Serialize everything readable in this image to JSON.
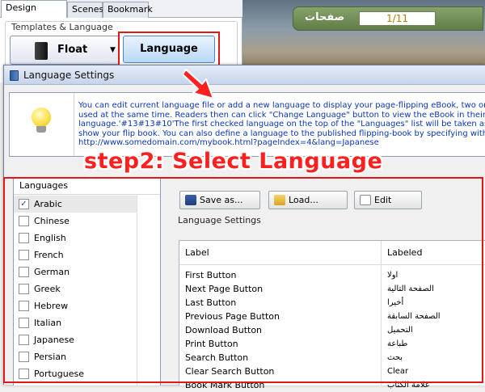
{
  "app": {
    "tabs": [
      "Design Setting",
      "Scenes",
      "Bookmark"
    ],
    "group_label": "Templates & Language",
    "float_label": "Float",
    "dropdown_glyph": "▼",
    "language_label": "Language"
  },
  "preview": {
    "page_counter": "1/11",
    "pages_label": "صفحات"
  },
  "dialog": {
    "title": "Language Settings",
    "info_lines": [
      "You can edit current language file or add a new language to display your page-flipping eBook, two or more",
      "used at the same time. Readers then can click \"Change Language\" button to view the eBook in their prefe",
      "language.'#13#13#10'The first checked language on the top of the \"Languages\" list will be taken as the d",
      "show your flip book. You can also define a language to the published flipping-book by specifying with the a",
      "http://www.somedomain.com/mybook.html?pageIndex=4&lang=Japanese"
    ],
    "languages_header": "Languages",
    "languages": [
      {
        "name": "Arabic",
        "checked": true
      },
      {
        "name": "Chinese",
        "checked": false
      },
      {
        "name": "English",
        "checked": false
      },
      {
        "name": "French",
        "checked": false
      },
      {
        "name": "German",
        "checked": false
      },
      {
        "name": "Greek",
        "checked": false
      },
      {
        "name": "Hebrew",
        "checked": false
      },
      {
        "name": "Italian",
        "checked": false
      },
      {
        "name": "Japanese",
        "checked": false
      },
      {
        "name": "Persian",
        "checked": false
      },
      {
        "name": "Portuguese",
        "checked": false
      }
    ],
    "toolbar": {
      "save": "Save as...",
      "load": "Load...",
      "edit": "Edit"
    },
    "settings_label": "Language Settings",
    "grid_headers": {
      "label": "Label",
      "labeled": "Labeled"
    },
    "rows": [
      {
        "label": "First Button",
        "value": "اولا"
      },
      {
        "label": "Next Page Button",
        "value": "الصفحة التالية"
      },
      {
        "label": "Last Button",
        "value": "أخيرا"
      },
      {
        "label": "Previous Page Button",
        "value": "الصفحة السابقة"
      },
      {
        "label": "Download Button",
        "value": "التحميل"
      },
      {
        "label": "Print Button",
        "value": "طباعة"
      },
      {
        "label": "Search Button",
        "value": "بحث"
      },
      {
        "label": "Clear Search Button",
        "value": "Clear"
      },
      {
        "label": "Book Mark Button",
        "value": "علامة الكتاب"
      }
    ]
  },
  "annotation": {
    "step_text": "step2: Select Language",
    "color": "#ff1f1f"
  }
}
